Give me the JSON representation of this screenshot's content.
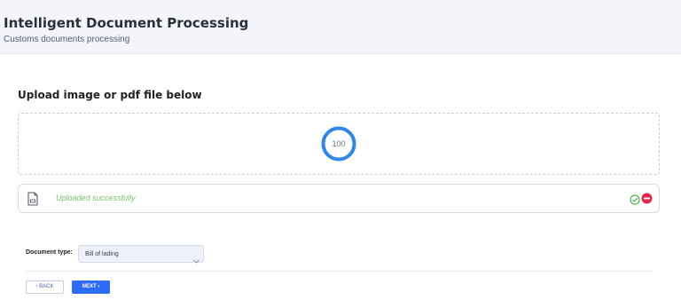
{
  "header": {
    "title": "Intelligent Document Processing",
    "subtitle": "Customs documents processing"
  },
  "upload": {
    "section_title": "Upload image or pdf file below",
    "progress": 100,
    "progress_label": "100",
    "status_text": "Uploaded successfully",
    "status_color": "#7cbf6f",
    "ring_color": "#2f86e6"
  },
  "form": {
    "document_type_label": "Document type:",
    "document_type_value": "Bill of lading"
  },
  "actions": {
    "back_label": "‹ BACK",
    "next_label": "NEXT ›"
  },
  "icons": {
    "file": "file-icon",
    "success": "check-circle-icon",
    "remove": "remove-circle-icon",
    "dropdown": "chevron-down-icon"
  },
  "colors": {
    "primary": "#2d6cf6",
    "danger": "#e0294a",
    "success": "#4caf50"
  }
}
